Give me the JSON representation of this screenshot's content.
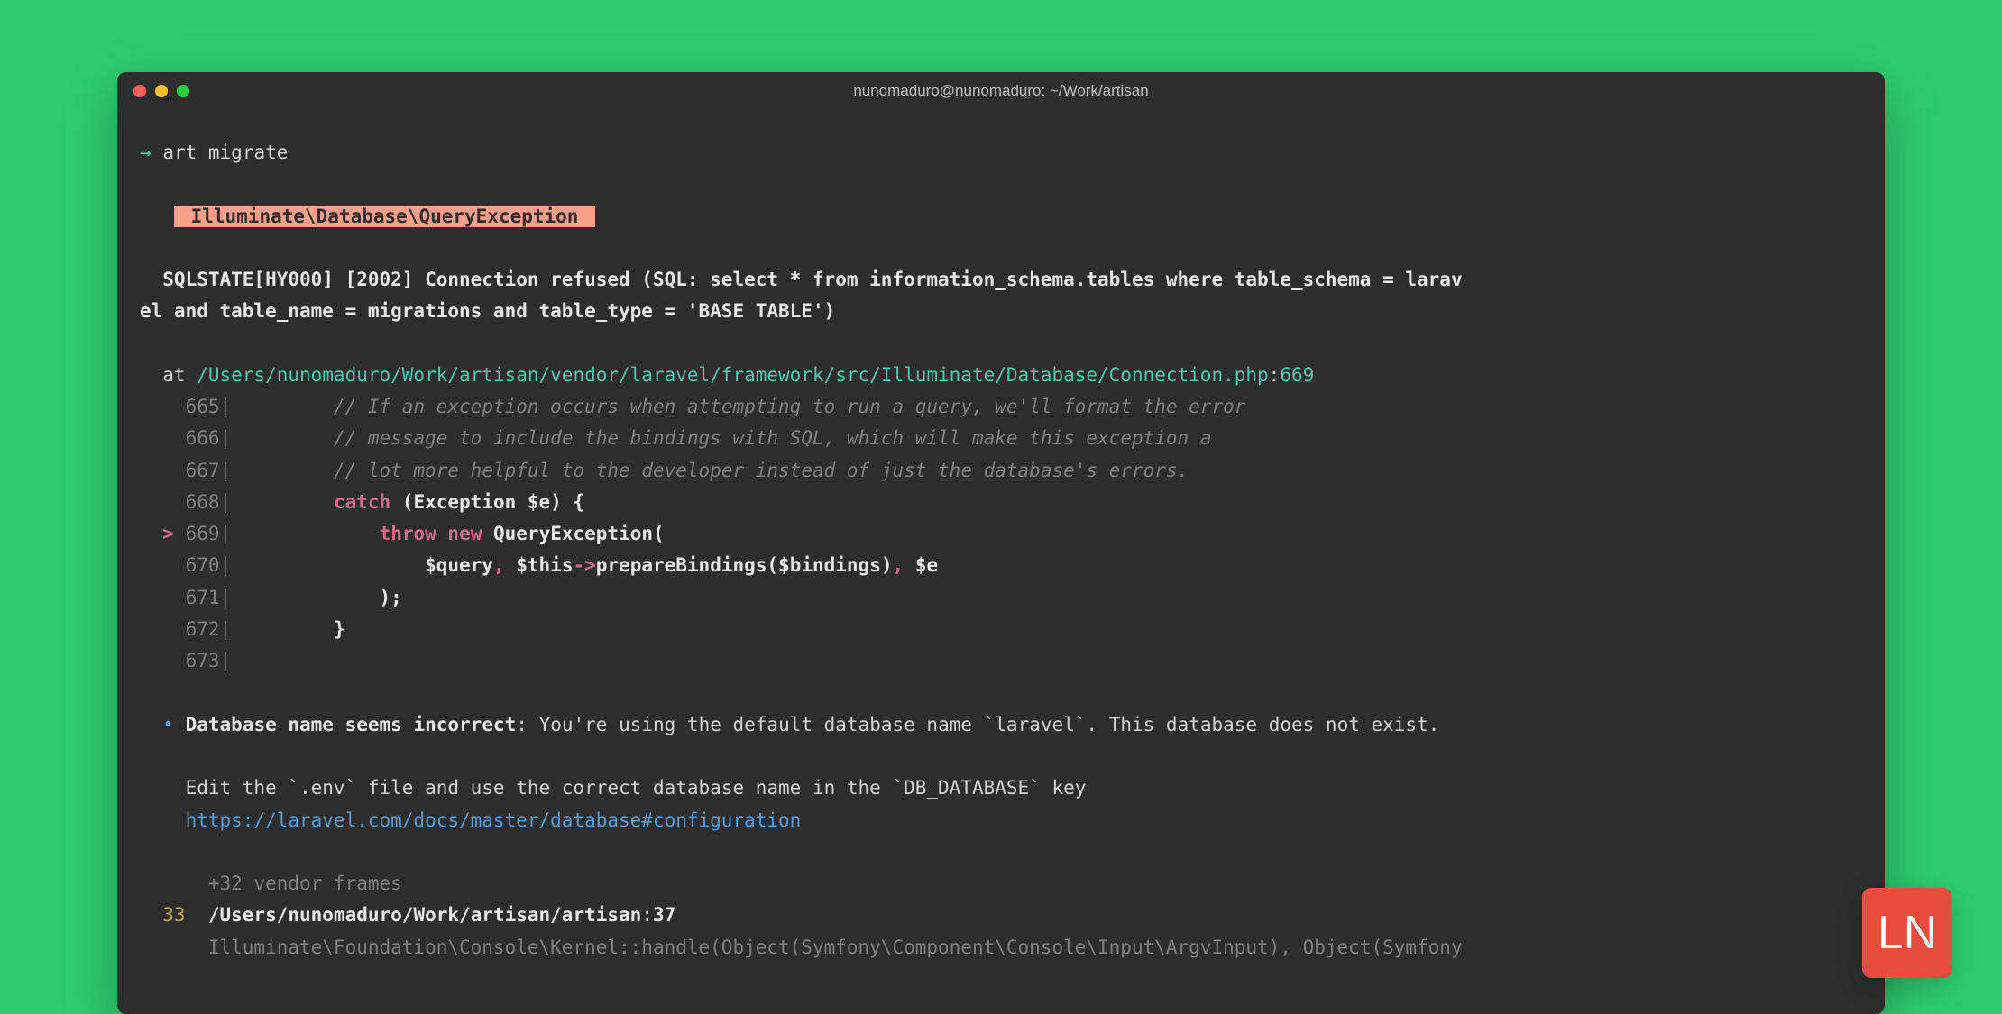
{
  "window": {
    "title": "nunomaduro@nunomaduro: ~/Work/artisan"
  },
  "prompt": {
    "arrow": "→",
    "command": "art migrate"
  },
  "exception": {
    "badge": " Illuminate\\Database\\QueryException ",
    "message": "  SQLSTATE[HY000] [2002] Connection refused (SQL: select * from information_schema.tables where table_schema = larav\nel and table_name = migrations and table_type = 'BASE TABLE')"
  },
  "trace": {
    "at_label": "  at ",
    "file": "/Users/nunomaduro/Work/artisan/vendor/laravel/framework/src/Illuminate/Database/Connection.php",
    "colon": ":",
    "line": "669"
  },
  "code": {
    "lines": [
      {
        "num": "665",
        "arrow": " ",
        "comment": "// If an exception occurs when attempting to run a query, we'll format the error"
      },
      {
        "num": "666",
        "arrow": " ",
        "comment": "// message to include the bindings with SQL, which will make this exception a"
      },
      {
        "num": "667",
        "arrow": " ",
        "comment": "// lot more helpful to the developer instead of just the database's errors."
      },
      {
        "num": "668",
        "arrow": " ",
        "catch": "catch ",
        "rest1": "(Exception $e) {"
      },
      {
        "num": "669",
        "arrow": ">",
        "throw": "throw new ",
        "rest2": "QueryException("
      },
      {
        "num": "670",
        "arrow": " ",
        "vars": "$query",
        "comma1": ", ",
        "vars2": "$this",
        "arrow_op": "->",
        "method": "prepareBindings($bindings)",
        "comma2": ", ",
        "vars3": "$e"
      },
      {
        "num": "671",
        "arrow": " ",
        "close": ");"
      },
      {
        "num": "672",
        "arrow": " ",
        "brace": "}"
      },
      {
        "num": "673",
        "arrow": " "
      }
    ]
  },
  "hint": {
    "bullet": "•",
    "title": "Database name seems incorrect",
    "colon": ": ",
    "desc": "You're using the default database name `laravel`. This database does not exist.",
    "edit": "    Edit the `.env` file and use the correct database name in the `DB_DATABASE` key",
    "link": "    https://laravel.com/docs/master/database#configuration"
  },
  "frames": {
    "vendor": "      +32 vendor frames",
    "num": "  33",
    "path": "  /Users/nunomaduro/Work/artisan/artisan",
    "colon": ":",
    "line": "37",
    "call": "      Illuminate\\Foundation\\Console\\Kernel::handle(Object(Symfony\\Component\\Console\\Input\\ArgvInput), Object(Symfony"
  },
  "logo": {
    "text": "LN"
  }
}
